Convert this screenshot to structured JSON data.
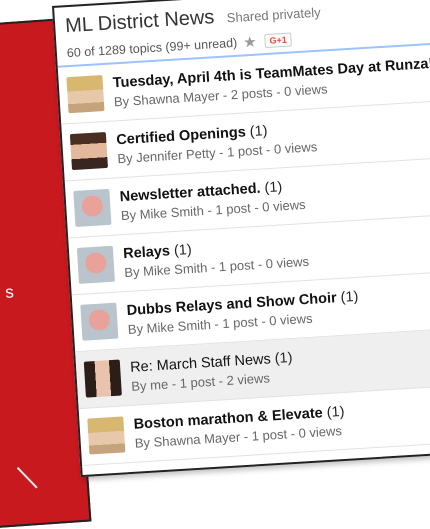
{
  "background": {
    "top_text": "s",
    "mid_text": "s"
  },
  "panel": {
    "title": "ML District News",
    "shared": "Shared privately",
    "topics_summary": "60 of 1289 topics (99+ unread)",
    "star_icon": "star-icon",
    "gplus_label": "G+1"
  },
  "topics": [
    {
      "subject": "Tuesday, April 4th is TeamMates Day at Runza!",
      "count": "",
      "bold": true,
      "meta": "By Shawna Mayer - 2 posts - 0 views",
      "avatar": "blonde",
      "highlight": false
    },
    {
      "subject": "Certified Openings",
      "count": "(1)",
      "bold": true,
      "meta": "By Jennifer Petty - 1 post - 0 views",
      "avatar": "brunette",
      "highlight": false
    },
    {
      "subject": "Newsletter attached.",
      "count": "(1)",
      "bold": true,
      "meta": "By Mike Smith - 1 post - 0 views",
      "avatar": "mike",
      "highlight": false
    },
    {
      "subject": "Relays",
      "count": "(1)",
      "bold": true,
      "meta": "By Mike Smith - 1 post - 0 views",
      "avatar": "mike",
      "highlight": false
    },
    {
      "subject": "Dubbs Relays and Show Choir",
      "count": "(1)",
      "bold": true,
      "meta": "By Mike Smith - 1 post - 0 views",
      "avatar": "mike",
      "highlight": false
    },
    {
      "subject": "Re: March Staff News",
      "count": "(1)",
      "bold": false,
      "meta": "By me - 1 post - 2 views",
      "avatar": "me",
      "highlight": true
    },
    {
      "subject": "Boston marathon & Elevate",
      "count": "(1)",
      "bold": true,
      "meta": "By Shawna Mayer - 1 post - 0 views",
      "avatar": "blonde",
      "highlight": false
    }
  ]
}
